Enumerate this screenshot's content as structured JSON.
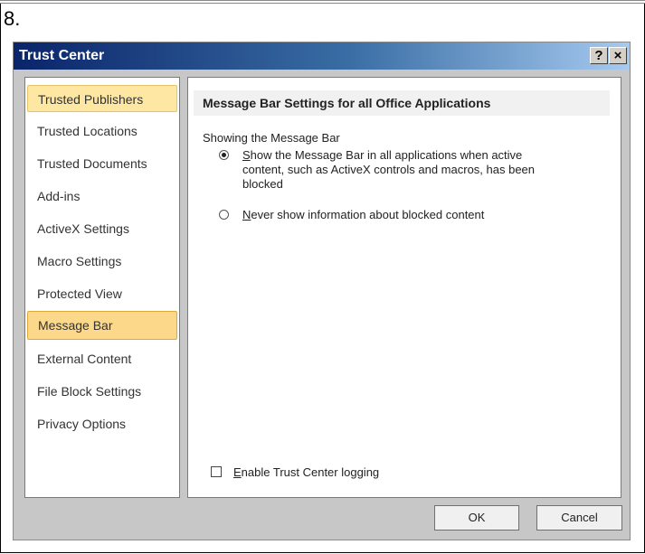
{
  "step": {
    "label": "8."
  },
  "window": {
    "title": "Trust Center",
    "help_label": "?",
    "close_label": "×"
  },
  "sidebar": {
    "items": [
      {
        "label": "Trusted Publishers"
      },
      {
        "label": "Trusted Locations"
      },
      {
        "label": "Trusted Documents"
      },
      {
        "label": "Add-ins"
      },
      {
        "label": "ActiveX Settings"
      },
      {
        "label": "Macro Settings"
      },
      {
        "label": "Protected View"
      },
      {
        "label": "Message Bar"
      },
      {
        "label": "External Content"
      },
      {
        "label": "File Block Settings"
      },
      {
        "label": "Privacy Options"
      }
    ]
  },
  "main": {
    "section_title": "Message Bar Settings for all Office Applications",
    "group_label": "Showing the Message Bar",
    "option_show": {
      "mnemonic": "S",
      "line1_rest": "how the Message Bar in all applications when active",
      "line2": "content, such as ActiveX controls and macros, has been",
      "line3": "blocked",
      "checked": true
    },
    "option_never": {
      "mnemonic": "N",
      "rest": "ever show information about blocked content",
      "checked": false
    },
    "logging": {
      "mnemonic": "E",
      "rest": "nable Trust Center logging",
      "checked": false
    }
  },
  "buttons": {
    "ok_label": "OK",
    "cancel_label": "Cancel"
  }
}
